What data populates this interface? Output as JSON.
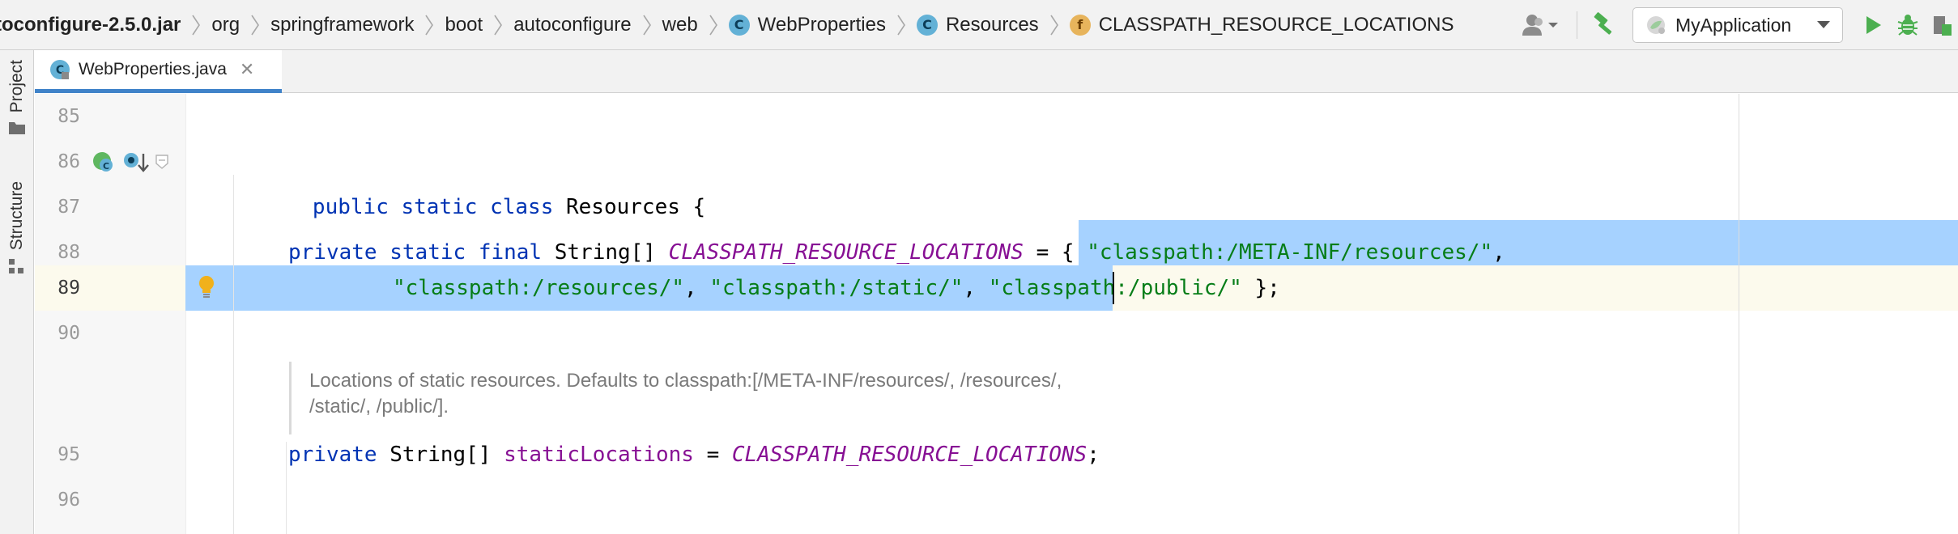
{
  "navbar": {
    "breadcrumbs": [
      {
        "label": "toconfigure-2.5.0.jar",
        "icon": ""
      },
      {
        "label": "org",
        "icon": ""
      },
      {
        "label": "springframework",
        "icon": ""
      },
      {
        "label": "boot",
        "icon": ""
      },
      {
        "label": "autoconfigure",
        "icon": ""
      },
      {
        "label": "web",
        "icon": ""
      },
      {
        "label": "WebProperties",
        "icon": "class-icon",
        "icon_glyph": "C"
      },
      {
        "label": "Resources",
        "icon": "inner-class-icon",
        "icon_glyph": "C"
      },
      {
        "label": "CLASSPATH_RESOURCE_LOCATIONS",
        "icon": "field-icon",
        "icon_glyph": "f"
      }
    ],
    "run_config": {
      "label": "MyApplication",
      "icon": "spring-boot-icon"
    },
    "toolbar_icons": [
      "user-icon",
      "hammer-build-icon",
      "run-icon",
      "debug-icon",
      "coverage-icon"
    ],
    "colors": {
      "run": "#4caf50",
      "debug": "#4caf50",
      "build": "#4caf50"
    }
  },
  "sidebar": {
    "tabs": [
      {
        "label": "Project",
        "icon": "folder-icon"
      },
      {
        "label": "Structure",
        "icon": "structure-icon"
      }
    ]
  },
  "editor": {
    "tab": {
      "label": "WebProperties.java",
      "icon": "class-icon",
      "icon_glyph": "C",
      "close_glyph": "✕"
    },
    "lines": [
      {
        "num": "85"
      },
      {
        "num": "86",
        "tokens": [
          {
            "t": "public ",
            "c": "kw"
          },
          {
            "t": "static ",
            "c": "kw"
          },
          {
            "t": "class ",
            "c": "kw"
          },
          {
            "t": "Resources {",
            "c": "cls"
          }
        ]
      },
      {
        "num": "87"
      },
      {
        "num": "88",
        "tokens": [
          {
            "t": "private ",
            "c": "kw"
          },
          {
            "t": "static ",
            "c": "kw"
          },
          {
            "t": "final ",
            "c": "kw"
          },
          {
            "t": "String[] ",
            "c": "cls"
          },
          {
            "t": "CLASSPATH_RESOURCE_LOCATIONS",
            "c": "cst"
          },
          {
            "t": " = { ",
            "c": "cls"
          },
          {
            "t": "\"classpath:/META-INF/resources/\"",
            "c": "str"
          },
          {
            "t": ",",
            "c": "cls"
          }
        ]
      },
      {
        "num": "89",
        "tokens": [
          {
            "t": "\"classpath:/resources/\"",
            "c": "str"
          },
          {
            "t": ", ",
            "c": "cls"
          },
          {
            "t": "\"classpath:/static/\"",
            "c": "str"
          },
          {
            "t": ", ",
            "c": "cls"
          },
          {
            "t": "\"classpath:/public/\"",
            "c": "str"
          },
          {
            "t": " };",
            "c": "cls"
          }
        ]
      },
      {
        "num": "90"
      },
      {
        "num": "95",
        "tokens": [
          {
            "t": "private ",
            "c": "kw"
          },
          {
            "t": "String[] ",
            "c": "cls"
          },
          {
            "t": "staticLocations",
            "c": "fld"
          },
          {
            "t": " = ",
            "c": "cls"
          },
          {
            "t": "CLASSPATH_RESOURCE_LOCATIONS",
            "c": "cst"
          },
          {
            "t": ";",
            "c": "cls"
          }
        ]
      },
      {
        "num": "96"
      }
    ],
    "doc_comment": {
      "line1": "Locations of static resources. Defaults to classpath:[/META-INF/resources/, /resources/,",
      "line2": "/static/, /public/]."
    },
    "gutter_icons": [
      "spring-bean-icon",
      "implemented-down-icon",
      "fold-marker-icon",
      "intention-bulb-icon"
    ]
  }
}
